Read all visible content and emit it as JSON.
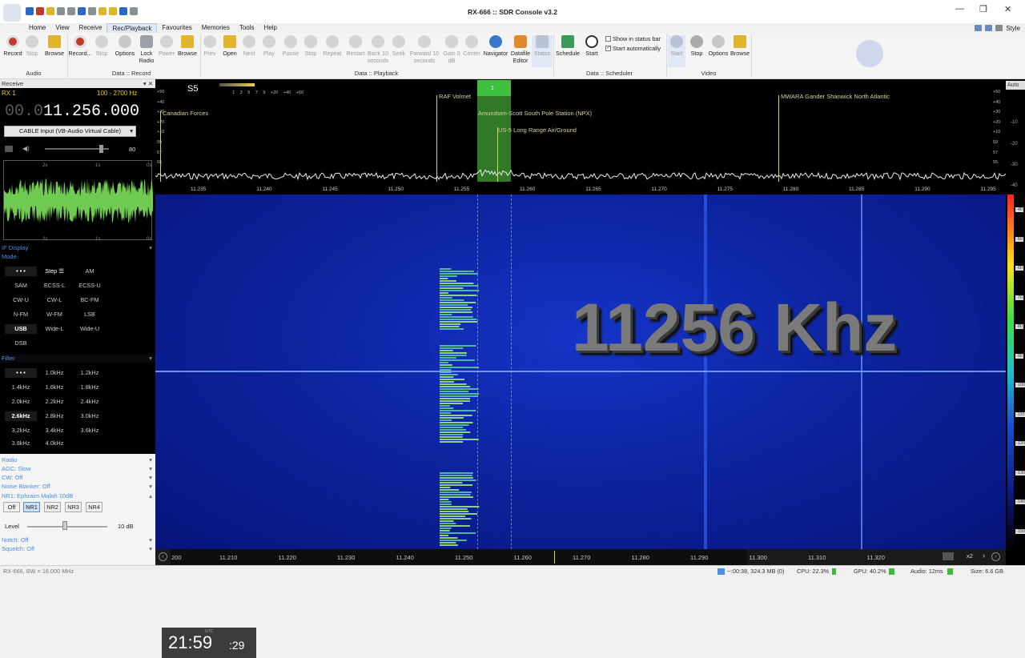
{
  "window": {
    "title": "RX-666 :: SDR Console v3.2"
  },
  "menu": [
    "Home",
    "View",
    "Receive",
    "Rec/Playback",
    "Favourites",
    "Memories",
    "Tools",
    "Help"
  ],
  "menu_active": "Rec/Playback",
  "style_label": "Style",
  "ribbon": {
    "audio": {
      "record": "Record",
      "stop": "Stop",
      "browse": "Browse",
      "group": "Audio"
    },
    "data_record": {
      "record": "Record...",
      "stop": "Stop",
      "options": "Options",
      "lock_radio": "Lock\nRadio",
      "power": "Power",
      "browse": "Browse",
      "group": "Data :: Record"
    },
    "data_playback": {
      "prev": "Prev",
      "open": "Open",
      "next": "Next",
      "play": "Play",
      "pause": "Pause",
      "stop": "Stop",
      "repeat": "Repeat",
      "restart": "Restart",
      "back10": "Back 10\nseconds",
      "seek": "Seek",
      "forward10": "Forward 10\nseconds",
      "gain": "Gain 0\ndB",
      "center": "Center",
      "navigator": "Navigator",
      "datafile_editor": "Datafile\nEditor",
      "status": "Status",
      "group": "Data :: Playback"
    },
    "scheduler": {
      "schedule": "Schedule",
      "start": "Start",
      "show_status": "Show in status bar",
      "start_auto": "Start automatically",
      "group": "Data :: Scheduler"
    },
    "video": {
      "start": "Start",
      "stop": "Stop",
      "options": "Options",
      "browse": "Browse",
      "group": "Video"
    }
  },
  "receive": {
    "header": "Receive",
    "rx": "RX 1",
    "bandwidth": "100 - 2700 Hz",
    "freq_dim": "00.0",
    "freq_main": "11.256.000",
    "input": "CABLE Input (VB-Audio Virtual Cable)",
    "volume": "80",
    "scope_ticks": [
      "2s",
      "1s",
      "0s"
    ]
  },
  "sections": {
    "if_display": "IF Display",
    "mode": "Mode",
    "filter": "Filter",
    "radio": "Radio",
    "agc": "AGC: Slow",
    "cw": "CW: Off",
    "noise_blanker": "Noise Blanker: Off",
    "nr1": "NR1: Ephraim Malah 10dB",
    "notch": "Notch: Off",
    "squelch": "Squelch: Off"
  },
  "modes": [
    "• • •",
    "Step ☰",
    "AM",
    "SAM",
    "ECSS-L",
    "ECSS-U",
    "CW-U",
    "CW-L",
    "BC-FM",
    "N-FM",
    "W-FM",
    "LSB",
    "USB",
    "Wide-L",
    "Wide-U",
    "DSB"
  ],
  "mode_selected": "USB",
  "filters": [
    "• • •",
    "1.0kHz",
    "1.2kHz",
    "1.4kHz",
    "1.6kHz",
    "1.8kHz",
    "2.0kHz",
    "2.2kHz",
    "2.4kHz",
    "2.6kHz",
    "2.8kHz",
    "3.0kHz",
    "3.2kHz",
    "3.4kHz",
    "3.6kHz",
    "3.8kHz",
    "4.0kHz"
  ],
  "filter_selected": "2.6kHz",
  "nr": [
    "Off",
    "NR1",
    "NR2",
    "NR3",
    "NR4"
  ],
  "nr_selected": "NR1",
  "level": {
    "label": "Level",
    "value": "10 dB"
  },
  "spectrum": {
    "smeter": "S5",
    "smeter_scale": [
      "1",
      "3",
      "5",
      "7",
      "9",
      "+20",
      "+40",
      "+60"
    ],
    "labels": {
      "canadian": "Canadian Forces",
      "raf": "RAF Volmet",
      "amundsen": "Amundsen-Scott South Pole Station (NPX)",
      "us5": "US-5 Long Range Air/Ground",
      "mwara": "MWARA Gander Shanwick North Atlantic"
    },
    "marker": "1",
    "auto": "Auto",
    "db_right": [
      "+50",
      "+40",
      "+30",
      "+20",
      "+10",
      "59",
      "57",
      "55"
    ],
    "db_left": [
      "+50",
      "+40",
      "+30",
      "+20",
      "+10",
      "59",
      "57",
      "55"
    ],
    "db_far": [
      "-10",
      "-20",
      "-30",
      "-40"
    ],
    "freq_ticks": [
      "11.235",
      "11.240",
      "11.245",
      "11.250",
      "11.255",
      "11.260",
      "11.265",
      "11.270",
      "11.275",
      "11.280",
      "11.285",
      "11.290",
      "11.295"
    ]
  },
  "waterfall": {
    "overlay_text": "11256 Khz",
    "time_label": "UTC",
    "time_hm": "21:59",
    "time_s": ":29",
    "color_scale": [
      "-40",
      "-50",
      "-60",
      "-70",
      "-80",
      "-90",
      "-100",
      "-110",
      "-120",
      "-130",
      "-140",
      "-150"
    ],
    "axis": [
      "200",
      "11.210",
      "11.220",
      "11.230",
      "11.240",
      "11.250",
      "11.260",
      "11.270",
      "11.280",
      "11.290",
      "11.300",
      "11.310",
      "11.320"
    ],
    "zoom": "x2"
  },
  "status": {
    "left": "RX-666, BW = 16.000 MHz",
    "record": "--:00:38, 324.3 MB (0)",
    "cpu": "CPU: 22.3%",
    "gpu": "GPU: 40.2%",
    "audio": "Audio: 12ms",
    "size": "Size: 6.6 GB"
  },
  "colors": {
    "accent_blue": "#4a90e2",
    "waterfall_deep": "#07147a",
    "signal_green": "#7de05a",
    "freq_yellow": "#f0d000"
  }
}
